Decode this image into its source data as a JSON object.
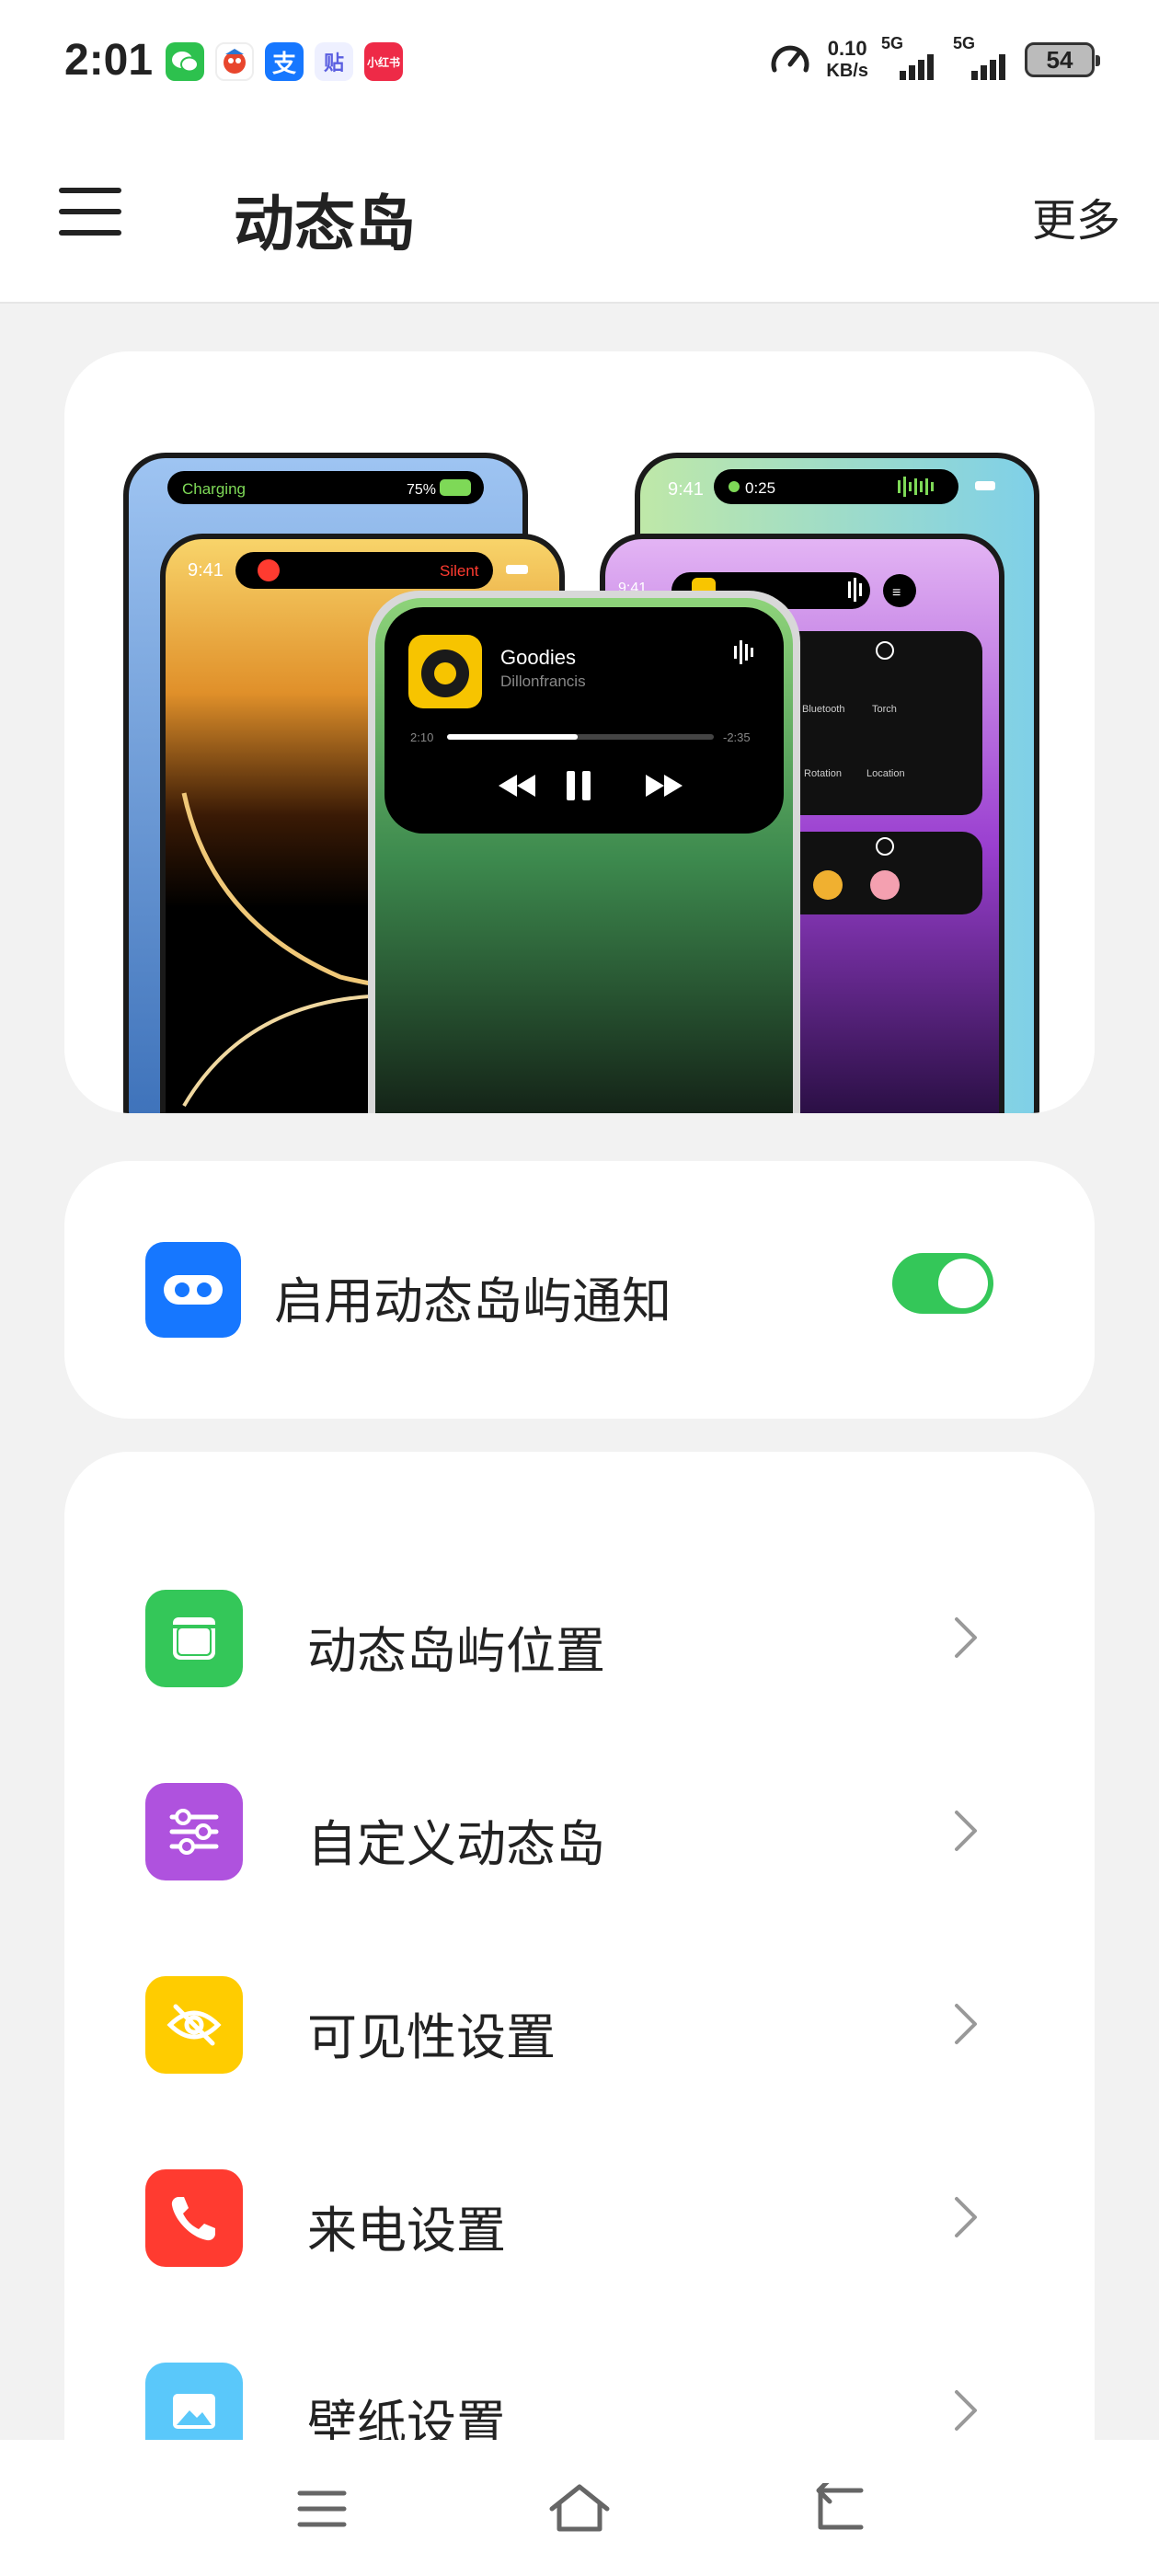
{
  "status_bar": {
    "time": "2:01",
    "apps": [
      {
        "icon": "wechat-icon",
        "glyph": "●●",
        "color": "#2dc14e"
      },
      {
        "icon": "game-app-icon",
        "glyph": "◉",
        "color": "#e8462d"
      },
      {
        "icon": "alipay-icon",
        "glyph": "支",
        "color": "#1677ff"
      },
      {
        "icon": "tieba-icon",
        "glyph": "贴",
        "color": "#5b5fe0"
      },
      {
        "icon": "xiaohongshu-icon",
        "glyph": "小红书",
        "color": "#ee2a47"
      }
    ],
    "net_speed_value": "0.10",
    "net_speed_unit": "KB/s",
    "sim1": "5G",
    "sim2": "5G",
    "battery": "54"
  },
  "app_bar": {
    "title": "动态岛",
    "more": "更多"
  },
  "preview": {
    "charging_label": "Charging",
    "charging_percent": "75%",
    "time_a": "9:41",
    "call_time": "0:25",
    "silent_label": "Silent",
    "song_title": "Goodies",
    "song_artist": "Dillonfrancis",
    "elapsed": "2:10",
    "remaining": "-2:35",
    "progress": 0.49,
    "cc_bluetooth": "Bluetooth",
    "cc_torch": "Torch",
    "cc_rotation": "Rotation",
    "cc_location": "Location"
  },
  "enable_toggle": {
    "label": "启用动态岛屿通知",
    "on": true,
    "color": "#34c759"
  },
  "settings": [
    {
      "label": "动态岛屿位置",
      "icon": "window-icon",
      "color": "#34c759"
    },
    {
      "label": "自定义动态岛",
      "icon": "sliders-icon",
      "color": "#af52de"
    },
    {
      "label": "可见性设置",
      "icon": "eye-off-icon",
      "color": "#ffcc00"
    },
    {
      "label": "来电设置",
      "icon": "phone-icon",
      "color": "#ff3b30"
    },
    {
      "label": "壁纸设置",
      "icon": "image-icon",
      "color": "#5ac8fa"
    }
  ]
}
